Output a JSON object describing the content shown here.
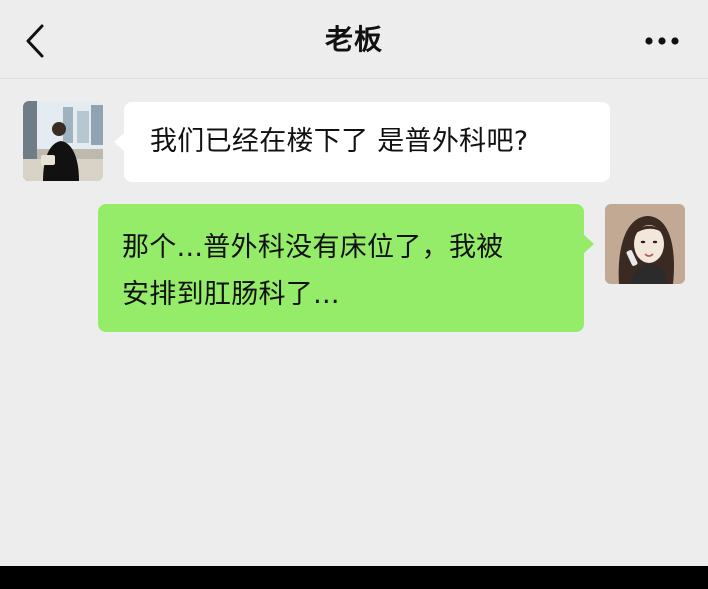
{
  "header": {
    "title": "老板",
    "back_icon": "chevron-left-icon",
    "more_icon": "more-dots-icon"
  },
  "messages": [
    {
      "side": "left",
      "text": "我们已经在楼下了 是普外科吧?"
    },
    {
      "side": "right",
      "lines": [
        "那个...普外科没有床位了，我被",
        "安排到肛肠科了..."
      ]
    }
  ],
  "colors": {
    "background": "#ededed",
    "incoming_bubble": "#ffffff",
    "outgoing_bubble": "#95ec69"
  }
}
